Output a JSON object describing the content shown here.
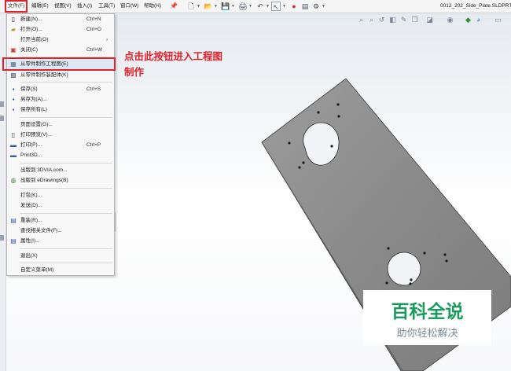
{
  "menubar": {
    "items": [
      {
        "label": "文件(F)"
      },
      {
        "label": "编辑(E)"
      },
      {
        "label": "视图(V)"
      },
      {
        "label": "插入(I)"
      },
      {
        "label": "工具(T)"
      },
      {
        "label": "窗口(W)"
      },
      {
        "label": "帮助(H)"
      }
    ],
    "title": "0012_202_Side_Plate.SLDPRT"
  },
  "file_menu": {
    "items": [
      {
        "label": "新建(N)...",
        "shortcut": "Ctrl+N",
        "icon": "new-document-icon"
      },
      {
        "label": "打开(O)...",
        "shortcut": "Ctrl+O",
        "icon": "open-folder-icon"
      },
      {
        "label": "打开当前(O)",
        "shortcut": "",
        "icon": "",
        "submenu": "›"
      },
      {
        "label": "关闭(C)",
        "shortcut": "Ctrl+W",
        "icon": "close-document-icon"
      },
      {
        "label": "从零件制作工程图(E)",
        "shortcut": "",
        "icon": "drawing-from-part-icon"
      },
      {
        "label": "从零件制作装配体(K)",
        "shortcut": "",
        "icon": "assembly-from-part-icon"
      },
      {
        "label": "保存(S)",
        "shortcut": "Ctrl+S",
        "icon": "save-icon"
      },
      {
        "label": "另存为(A)...",
        "shortcut": "",
        "icon": "save-as-icon"
      },
      {
        "label": "保存所有(L)",
        "shortcut": "",
        "icon": "save-all-icon"
      },
      {
        "label": "页面设置(G)...",
        "shortcut": "",
        "icon": ""
      },
      {
        "label": "打印预览(V)...",
        "shortcut": "",
        "icon": "print-preview-icon"
      },
      {
        "label": "打印(P)...",
        "shortcut": "Ctrl+P",
        "icon": "print-icon"
      },
      {
        "label": "Print3D...",
        "shortcut": "",
        "icon": "print3d-icon"
      },
      {
        "label": "出版到 3DVIA.com...",
        "shortcut": "",
        "icon": ""
      },
      {
        "label": "出版到 eDrawings(B)",
        "shortcut": "",
        "icon": "edrawings-icon"
      },
      {
        "label": "打包(K)...",
        "shortcut": "",
        "icon": ""
      },
      {
        "label": "发送(D)...",
        "shortcut": "",
        "icon": ""
      },
      {
        "label": "重装(R)...",
        "shortcut": "",
        "icon": "reload-icon"
      },
      {
        "label": "查找相关文件(F)...",
        "shortcut": "",
        "icon": ""
      },
      {
        "label": "属性(I)...",
        "shortcut": "",
        "icon": "properties-icon"
      },
      {
        "label": "退出(X)",
        "shortcut": "",
        "icon": ""
      },
      {
        "label": "自定义菜单(M)",
        "shortcut": "",
        "icon": ""
      }
    ]
  },
  "annotation": {
    "line1": "点击此按钮进入工程图",
    "line2": "制作"
  },
  "watermark": {
    "title": "百科全说",
    "subtitle": "助你轻松解决"
  },
  "colors": {
    "highlight_red": "#e0202a",
    "watermark_green": "#1a9a5c"
  }
}
